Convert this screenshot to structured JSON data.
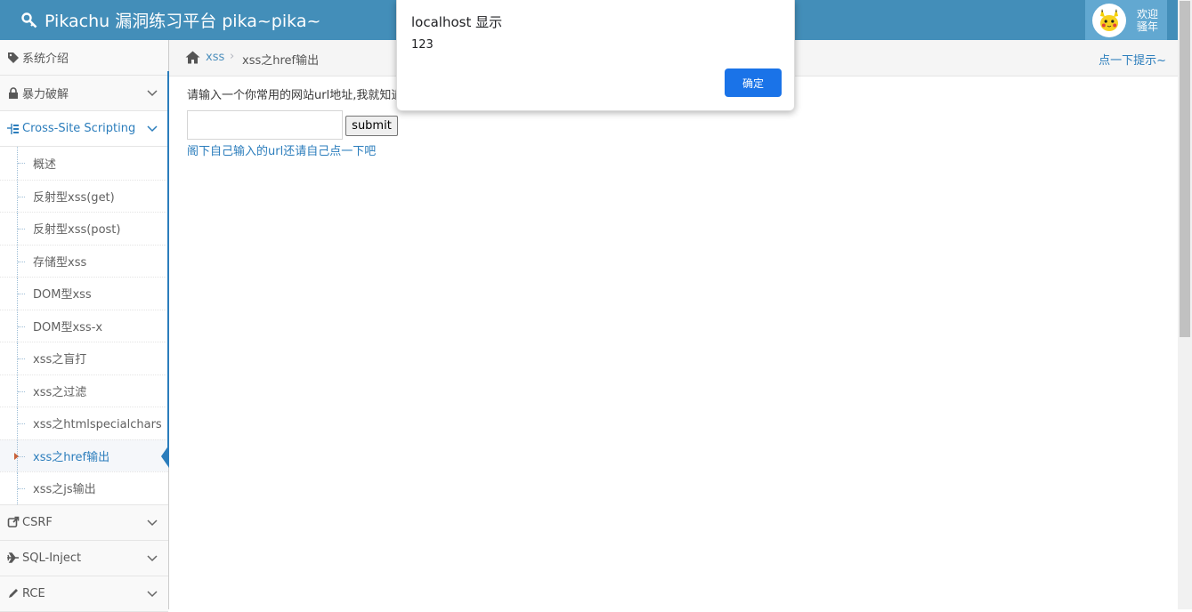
{
  "header": {
    "brand": "Pikachu 漏洞练习平台 pika~pika~",
    "welcome": "欢迎",
    "username": "骚年"
  },
  "sidebar": {
    "items": [
      {
        "label": "系统介绍",
        "icon": "tag-icon"
      },
      {
        "label": "暴力破解",
        "icon": "lock-icon"
      },
      {
        "label": "Cross-Site Scripting",
        "icon": "xss-icon"
      },
      {
        "label": "CSRF",
        "icon": "share-icon"
      },
      {
        "label": "SQL-Inject",
        "icon": "plane-icon"
      },
      {
        "label": "RCE",
        "icon": "pencil-icon"
      }
    ],
    "xss_subitems": [
      "概述",
      "反射型xss(get)",
      "反射型xss(post)",
      "存储型xss",
      "DOM型xss",
      "DOM型xss-x",
      "xss之盲打",
      "xss之过滤",
      "xss之htmlspecialchars",
      "xss之href输出",
      "xss之js输出"
    ]
  },
  "breadcrumb": {
    "link": "xss",
    "separator": "›",
    "current": "xss之href输出",
    "hint": "点一下提示~"
  },
  "main": {
    "prompt": "请输入一个你常用的网站url地址,我就知道你是什么人",
    "input_value": "",
    "submit_label": "submit",
    "result_text": "阁下自己输入的url还请自己点一下吧"
  },
  "dialog": {
    "title": "localhost 显示",
    "message": "123",
    "ok_label": "确定"
  },
  "colors": {
    "navbar": "#438eb9",
    "accent": "#2b7dbc",
    "dialog_button": "#1a73e8"
  }
}
